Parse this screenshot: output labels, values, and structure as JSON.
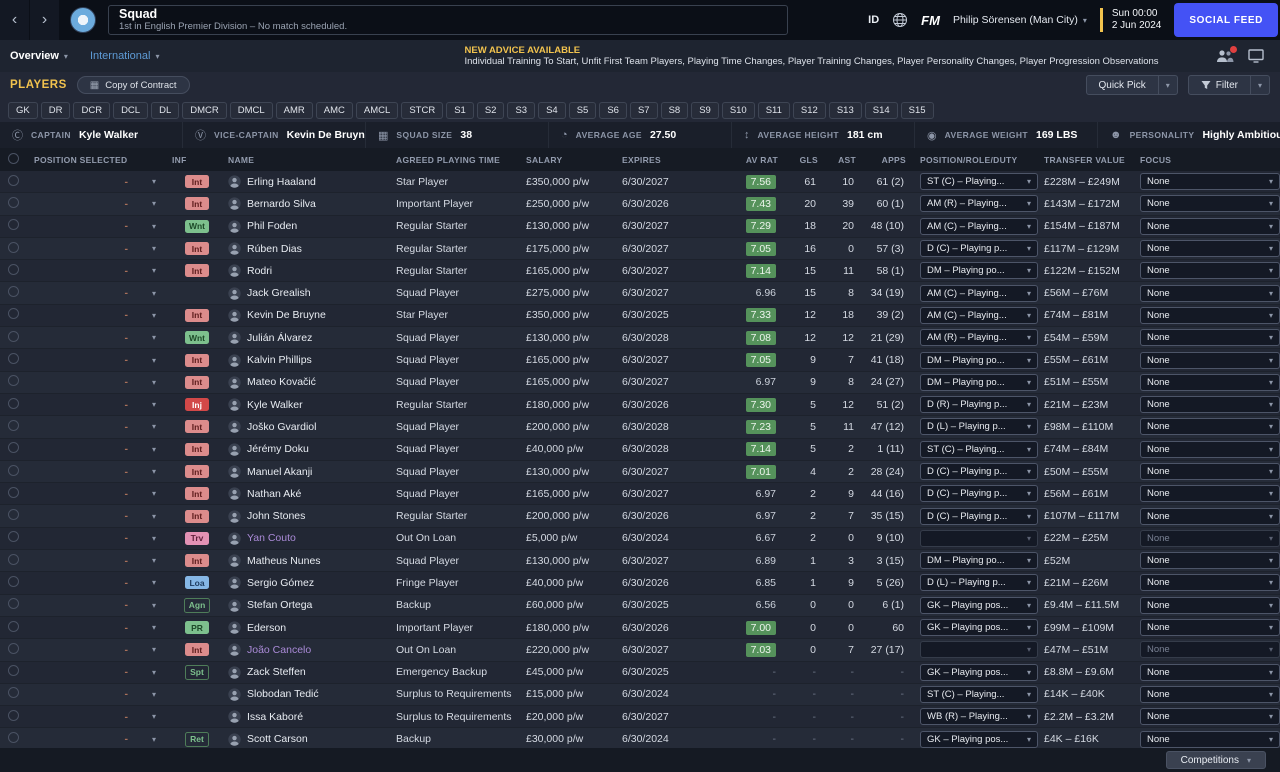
{
  "colors": {
    "accent_yellow": "#f2c34e",
    "social_feed_blue": "#4452f5",
    "rating_green": "#55925b",
    "loan_name_purple": "#ab8bd8"
  },
  "titlebar": {
    "title": "Squad",
    "subtitle": "1st in English Premier Division – No match scheduled.",
    "id_label": "ID",
    "fm_label": "FM",
    "manager": "Philip Sörensen (Man City)",
    "date_line1": "Sun 00:00",
    "date_line2": "2 Jun 2024",
    "social_feed": "SOCIAL FEED"
  },
  "nav": {
    "tabs": [
      {
        "label": "Overview"
      },
      {
        "label": "International"
      }
    ],
    "advice_title": "NEW ADVICE AVAILABLE",
    "advice_text": "Individual Training To Start, Unfit First Team Players, Playing Time Changes, Player Training Changes, Player Personality Changes, Player Progression Observations"
  },
  "toolbar": {
    "players_label": "PLAYERS",
    "view_label": "Copy of Contract",
    "quick_pick": "Quick Pick",
    "filter": "Filter"
  },
  "positions": [
    "GK",
    "DR",
    "DCR",
    "DCL",
    "DL",
    "DMCR",
    "DMCL",
    "AMR",
    "AMC",
    "AMCL",
    "STCR",
    "S1",
    "S2",
    "S3",
    "S4",
    "S5",
    "S6",
    "S7",
    "S8",
    "S9",
    "S10",
    "S11",
    "S12",
    "S13",
    "S14",
    "S15"
  ],
  "squad_info": [
    {
      "icon": "Ⓒ",
      "label": "CAPTAIN",
      "value": "Kyle Walker"
    },
    {
      "icon": "Ⓥ",
      "label": "VICE-CAPTAIN",
      "value": "Kevin De Bruyne"
    },
    {
      "icon": "▦",
      "label": "SQUAD SIZE",
      "value": "38"
    },
    {
      "icon": "◔",
      "label": "AVERAGE AGE",
      "value": "27.50"
    },
    {
      "icon": "↕",
      "label": "AVERAGE HEIGHT",
      "value": "181 cm"
    },
    {
      "icon": "◉",
      "label": "AVERAGE WEIGHT",
      "value": "169 LBS"
    },
    {
      "icon": "☻",
      "label": "PERSONALITY",
      "value": "Highly Ambitious"
    }
  ],
  "table": {
    "position_selected_placeholder": "-",
    "headers": [
      "POSITION SELECTED",
      "INF",
      "NAME",
      "AGREED PLAYING TIME",
      "SALARY",
      "EXPIRES",
      "AV RAT",
      "GLS",
      "AST",
      "APPS",
      "POSITION/ROLE/DUTY",
      "TRANSFER VALUE",
      "FOCUS"
    ],
    "rows": [
      {
        "inf": "Int",
        "inf_type": "int",
        "name": "Erling Haaland",
        "loan": false,
        "playing_time": "Star Player",
        "salary": "£350,000 p/w",
        "expires": "6/30/2027",
        "av_rat": "7.56",
        "rat_badge": true,
        "gls": "61",
        "ast": "10",
        "apps": "61 (2)",
        "position": "ST (C) – Playing...",
        "transfer_value": "£228M – £249M",
        "focus": "None"
      },
      {
        "inf": "Int",
        "inf_type": "int",
        "name": "Bernardo Silva",
        "loan": false,
        "playing_time": "Important Player",
        "salary": "£250,000 p/w",
        "expires": "6/30/2026",
        "av_rat": "7.43",
        "rat_badge": true,
        "gls": "20",
        "ast": "39",
        "apps": "60 (1)",
        "position": "AM (R) – Playing...",
        "transfer_value": "£143M – £172M",
        "focus": "None"
      },
      {
        "inf": "Wnt",
        "inf_type": "wnt",
        "name": "Phil Foden",
        "loan": false,
        "playing_time": "Regular Starter",
        "salary": "£130,000 p/w",
        "expires": "6/30/2027",
        "av_rat": "7.29",
        "rat_badge": true,
        "gls": "18",
        "ast": "20",
        "apps": "48 (10)",
        "position": "AM (C) – Playing...",
        "transfer_value": "£154M – £187M",
        "focus": "None"
      },
      {
        "inf": "Int",
        "inf_type": "int",
        "name": "Rúben Dias",
        "loan": false,
        "playing_time": "Regular Starter",
        "salary": "£175,000 p/w",
        "expires": "6/30/2027",
        "av_rat": "7.05",
        "rat_badge": true,
        "gls": "16",
        "ast": "0",
        "apps": "57 (3)",
        "position": "D (C) – Playing p...",
        "transfer_value": "£117M – £129M",
        "focus": "None"
      },
      {
        "inf": "Int",
        "inf_type": "int",
        "name": "Rodri",
        "loan": false,
        "playing_time": "Regular Starter",
        "salary": "£165,000 p/w",
        "expires": "6/30/2027",
        "av_rat": "7.14",
        "rat_badge": true,
        "gls": "15",
        "ast": "11",
        "apps": "58 (1)",
        "position": "DM – Playing po...",
        "transfer_value": "£122M – £152M",
        "focus": "None"
      },
      {
        "inf": "",
        "inf_type": "",
        "name": "Jack Grealish",
        "loan": false,
        "playing_time": "Squad Player",
        "salary": "£275,000 p/w",
        "expires": "6/30/2027",
        "av_rat": "6.96",
        "rat_badge": false,
        "gls": "15",
        "ast": "8",
        "apps": "34 (19)",
        "position": "AM (C) – Playing...",
        "transfer_value": "£56M – £76M",
        "focus": "None"
      },
      {
        "inf": "Int",
        "inf_type": "int",
        "name": "Kevin De Bruyne",
        "loan": false,
        "playing_time": "Star Player",
        "salary": "£350,000 p/w",
        "expires": "6/30/2025",
        "av_rat": "7.33",
        "rat_badge": true,
        "gls": "12",
        "ast": "18",
        "apps": "39 (2)",
        "position": "AM (C) – Playing...",
        "transfer_value": "£74M – £81M",
        "focus": "None"
      },
      {
        "inf": "Wnt",
        "inf_type": "wnt",
        "name": "Julián Álvarez",
        "loan": false,
        "playing_time": "Squad Player",
        "salary": "£130,000 p/w",
        "expires": "6/30/2028",
        "av_rat": "7.08",
        "rat_badge": true,
        "gls": "12",
        "ast": "12",
        "apps": "21 (29)",
        "position": "AM (R) – Playing...",
        "transfer_value": "£54M – £59M",
        "focus": "None"
      },
      {
        "inf": "Int",
        "inf_type": "int",
        "name": "Kalvin Phillips",
        "loan": false,
        "playing_time": "Squad Player",
        "salary": "£165,000 p/w",
        "expires": "6/30/2027",
        "av_rat": "7.05",
        "rat_badge": true,
        "gls": "9",
        "ast": "7",
        "apps": "41 (18)",
        "position": "DM – Playing po...",
        "transfer_value": "£55M – £61M",
        "focus": "None"
      },
      {
        "inf": "Int",
        "inf_type": "int",
        "name": "Mateo Kovačić",
        "loan": false,
        "playing_time": "Squad Player",
        "salary": "£165,000 p/w",
        "expires": "6/30/2027",
        "av_rat": "6.97",
        "rat_badge": false,
        "gls": "9",
        "ast": "8",
        "apps": "24 (27)",
        "position": "DM – Playing po...",
        "transfer_value": "£51M – £55M",
        "focus": "None"
      },
      {
        "inf": "Inj",
        "inf_type": "inj",
        "name": "Kyle Walker",
        "loan": false,
        "playing_time": "Regular Starter",
        "salary": "£180,000 p/w",
        "expires": "6/30/2026",
        "av_rat": "7.30",
        "rat_badge": true,
        "gls": "5",
        "ast": "12",
        "apps": "51 (2)",
        "position": "D (R) – Playing p...",
        "transfer_value": "£21M – £23M",
        "focus": "None"
      },
      {
        "inf": "Int",
        "inf_type": "int",
        "name": "Joško Gvardiol",
        "loan": false,
        "playing_time": "Squad Player",
        "salary": "£200,000 p/w",
        "expires": "6/30/2028",
        "av_rat": "7.23",
        "rat_badge": true,
        "gls": "5",
        "ast": "11",
        "apps": "47 (12)",
        "position": "D (L) – Playing p...",
        "transfer_value": "£98M – £110M",
        "focus": "None"
      },
      {
        "inf": "Int",
        "inf_type": "int",
        "name": "Jérémy Doku",
        "loan": false,
        "playing_time": "Squad Player",
        "salary": "£40,000 p/w",
        "expires": "6/30/2028",
        "av_rat": "7.14",
        "rat_badge": true,
        "gls": "5",
        "ast": "2",
        "apps": "1 (11)",
        "position": "ST (C) – Playing...",
        "transfer_value": "£74M – £84M",
        "focus": "None"
      },
      {
        "inf": "Int",
        "inf_type": "int",
        "name": "Manuel Akanji",
        "loan": false,
        "playing_time": "Squad Player",
        "salary": "£130,000 p/w",
        "expires": "6/30/2027",
        "av_rat": "7.01",
        "rat_badge": true,
        "gls": "4",
        "ast": "2",
        "apps": "28 (24)",
        "position": "D (C) – Playing p...",
        "transfer_value": "£50M – £55M",
        "focus": "None"
      },
      {
        "inf": "Int",
        "inf_type": "int",
        "name": "Nathan Aké",
        "loan": false,
        "playing_time": "Squad Player",
        "salary": "£165,000 p/w",
        "expires": "6/30/2027",
        "av_rat": "6.97",
        "rat_badge": false,
        "gls": "2",
        "ast": "9",
        "apps": "44 (16)",
        "position": "D (C) – Playing p...",
        "transfer_value": "£56M – £61M",
        "focus": "None"
      },
      {
        "inf": "Int",
        "inf_type": "int",
        "name": "John Stones",
        "loan": false,
        "playing_time": "Regular Starter",
        "salary": "£200,000 p/w",
        "expires": "6/30/2026",
        "av_rat": "6.97",
        "rat_badge": false,
        "gls": "2",
        "ast": "7",
        "apps": "35 (15)",
        "position": "D (C) – Playing p...",
        "transfer_value": "£107M – £117M",
        "focus": "None"
      },
      {
        "inf": "Trv",
        "inf_type": "trv",
        "name": "Yan Couto",
        "loan": true,
        "playing_time": "Out On Loan",
        "salary": "£5,000 p/w",
        "expires": "6/30/2024",
        "av_rat": "6.67",
        "rat_badge": false,
        "gls": "2",
        "ast": "0",
        "apps": "9 (10)",
        "position": "",
        "transfer_value": "£22M – £25M",
        "focus": "None"
      },
      {
        "inf": "Int",
        "inf_type": "int",
        "name": "Matheus Nunes",
        "loan": false,
        "playing_time": "Squad Player",
        "salary": "£130,000 p/w",
        "expires": "6/30/2027",
        "av_rat": "6.89",
        "rat_badge": false,
        "gls": "1",
        "ast": "3",
        "apps": "3 (15)",
        "position": "DM – Playing po...",
        "transfer_value": "£52M",
        "focus": "None"
      },
      {
        "inf": "Loa",
        "inf_type": "loa",
        "name": "Sergio Gómez",
        "loan": false,
        "playing_time": "Fringe Player",
        "salary": "£40,000 p/w",
        "expires": "6/30/2026",
        "av_rat": "6.85",
        "rat_badge": false,
        "gls": "1",
        "ast": "9",
        "apps": "5 (26)",
        "position": "D (L) – Playing p...",
        "transfer_value": "£21M – £26M",
        "focus": "None"
      },
      {
        "inf": "Agn",
        "inf_type": "agn",
        "name": "Stefan Ortega",
        "loan": false,
        "playing_time": "Backup",
        "salary": "£60,000 p/w",
        "expires": "6/30/2025",
        "av_rat": "6.56",
        "rat_badge": false,
        "gls": "0",
        "ast": "0",
        "apps": "6 (1)",
        "position": "GK – Playing pos...",
        "transfer_value": "£9.4M – £11.5M",
        "focus": "None"
      },
      {
        "inf": "PR",
        "inf_type": "pr",
        "name": "Ederson",
        "loan": false,
        "playing_time": "Important Player",
        "salary": "£180,000 p/w",
        "expires": "6/30/2026",
        "av_rat": "7.00",
        "rat_badge": true,
        "gls": "0",
        "ast": "0",
        "apps": "60",
        "position": "GK – Playing pos...",
        "transfer_value": "£99M – £109M",
        "focus": "None"
      },
      {
        "inf": "Int",
        "inf_type": "int",
        "name": "João Cancelo",
        "loan": true,
        "playing_time": "Out On Loan",
        "salary": "£220,000 p/w",
        "expires": "6/30/2027",
        "av_rat": "7.03",
        "rat_badge": true,
        "gls": "0",
        "ast": "7",
        "apps": "27 (17)",
        "position": "",
        "transfer_value": "£47M – £51M",
        "focus": "None"
      },
      {
        "inf": "Spt",
        "inf_type": "spt",
        "name": "Zack Steffen",
        "loan": false,
        "playing_time": "Emergency Backup",
        "salary": "£45,000 p/w",
        "expires": "6/30/2025",
        "av_rat": "-",
        "rat_badge": false,
        "gls": "-",
        "ast": "-",
        "apps": "-",
        "position": "GK – Playing pos...",
        "transfer_value": "£8.8M – £9.6M",
        "focus": "None"
      },
      {
        "inf": "",
        "inf_type": "",
        "name": "Slobodan Tedić",
        "loan": false,
        "playing_time": "Surplus to Requirements",
        "salary": "£15,000 p/w",
        "expires": "6/30/2024",
        "av_rat": "-",
        "rat_badge": false,
        "gls": "-",
        "ast": "-",
        "apps": "-",
        "position": "ST (C) – Playing...",
        "transfer_value": "£14K – £40K",
        "focus": "None"
      },
      {
        "inf": "",
        "inf_type": "",
        "name": "Issa Kaboré",
        "loan": false,
        "playing_time": "Surplus to Requirements",
        "salary": "£20,000 p/w",
        "expires": "6/30/2027",
        "av_rat": "-",
        "rat_badge": false,
        "gls": "-",
        "ast": "-",
        "apps": "-",
        "position": "WB (R) – Playing...",
        "transfer_value": "£2.2M – £3.2M",
        "focus": "None"
      },
      {
        "inf": "Ret",
        "inf_type": "ret",
        "name": "Scott Carson",
        "loan": false,
        "playing_time": "Backup",
        "salary": "£30,000 p/w",
        "expires": "6/30/2024",
        "av_rat": "-",
        "rat_badge": false,
        "gls": "-",
        "ast": "-",
        "apps": "-",
        "position": "GK – Playing pos...",
        "transfer_value": "£4K – £16K",
        "focus": "None"
      }
    ]
  },
  "footer": {
    "competitions": "Competitions"
  }
}
